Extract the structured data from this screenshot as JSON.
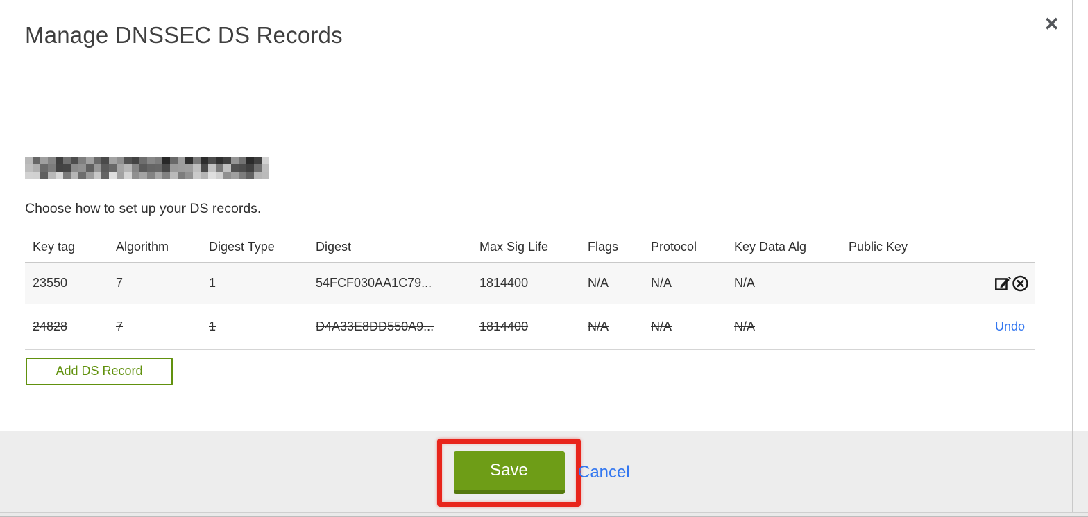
{
  "modal": {
    "title": "Manage DNSSEC DS Records",
    "close_glyph": "✕",
    "instruction": "Choose how to set up your DS records."
  },
  "table": {
    "columns": [
      "Key tag",
      "Algorithm",
      "Digest Type",
      "Digest",
      "Max Sig Life",
      "Flags",
      "Protocol",
      "Key Data Alg",
      "Public Key"
    ],
    "rows": [
      {
        "cells": [
          "23550",
          "7",
          "1",
          "54FCF030AA1C79...",
          "1814400",
          "N/A",
          "N/A",
          "N/A",
          ""
        ],
        "deleted": false,
        "actions": [
          "edit",
          "delete"
        ]
      },
      {
        "cells": [
          "24828",
          "7",
          "1",
          "D4A33E8DD550A9...",
          "1814400",
          "N/A",
          "N/A",
          "N/A",
          ""
        ],
        "deleted": true,
        "actions": [
          "undo"
        ]
      }
    ]
  },
  "actions": {
    "add_ds_record_label": "Add DS Record",
    "save_label": "Save",
    "cancel_label": "Cancel",
    "undo_label": "Undo"
  },
  "colors": {
    "save_green": "#6e9d17",
    "save_green_dark": "#55790e",
    "add_button_green": "#61910e",
    "link_blue": "#3377f0",
    "annotation_red": "#e8251c",
    "footer_gray": "#ededed",
    "row_stripe_gray": "#f7f7f7",
    "icon_dark": "#1a1a1a"
  }
}
